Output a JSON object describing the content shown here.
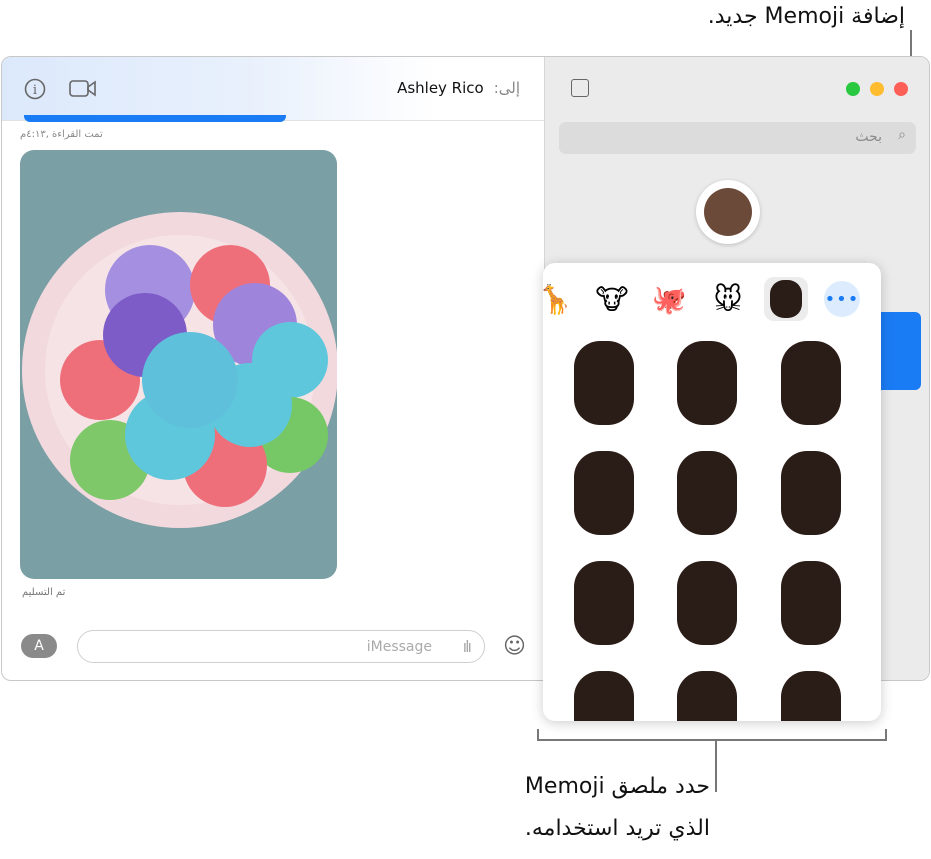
{
  "callouts": {
    "top": "إضافة Memoji جديد.",
    "bottom_line1": "حدد ملصق Memoji",
    "bottom_line2": "الذي تريد استخدامه."
  },
  "header": {
    "to_label": "إلى:",
    "recipient": "Ashley Rico",
    "icons": [
      "info-icon",
      "video-icon"
    ]
  },
  "messages": {
    "read_status": "تمت القراءة ,٤:١٣م",
    "delivered_status": "تم التسليم"
  },
  "compose": {
    "placeholder": "iMessage"
  },
  "sidebar": {
    "search_placeholder": "بحث"
  },
  "sticker_tabs": [
    "giraffe",
    "cow",
    "octopus",
    "mouse",
    "memoji",
    "more"
  ],
  "colors": {
    "accent": "#1a7cf5",
    "close": "#fe5f57",
    "minimize": "#febc2e",
    "zoom": "#28c840"
  }
}
